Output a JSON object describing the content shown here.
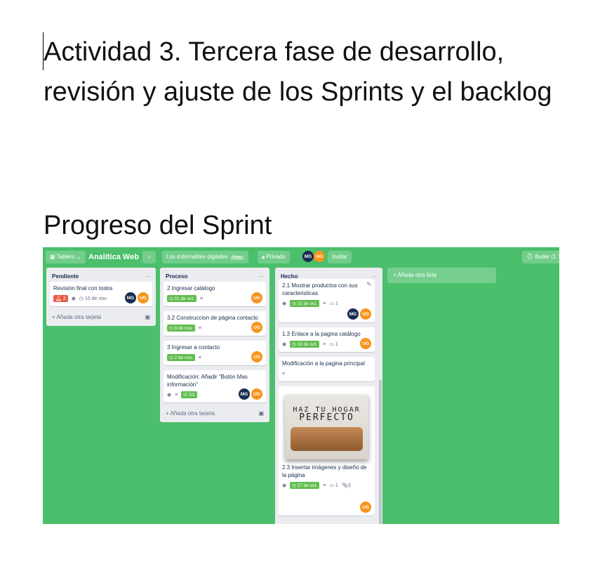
{
  "doc": {
    "title": "Actividad 3. Tercera fase de desarrollo, revisión y ajuste de los Sprints y el backlog",
    "heading": "Progreso del Sprint"
  },
  "board": {
    "tablero": "Tablero",
    "name": "Analítica Web",
    "workspace": "Los indomables digitales",
    "free": "Free",
    "privacy": "Privado",
    "invite": "Invitar",
    "butler": "Butler (1 T",
    "add_card": "Añada otra tarjeta",
    "add_list": "Añada otra lista",
    "lists": [
      {
        "title": "Pendiente",
        "cards": [
          {
            "title": "Revisión final con todos",
            "notifications": "3",
            "due": "10 de nov.",
            "members": [
              "MG",
              "UG"
            ]
          }
        ]
      },
      {
        "title": "Proceso",
        "cards": [
          {
            "title": "2 Ingresar catálogo",
            "due": "21 de oct.",
            "members": [
              "UG"
            ]
          },
          {
            "title": "3.2 Construccion de página contacto",
            "due": "9 de nov.",
            "members": [
              "UG"
            ]
          },
          {
            "title": "3 Ingresar a contacto",
            "due": "2 de nov.",
            "members": [
              "UG"
            ]
          },
          {
            "title": "Modificación: Añadir \"Botón Mas información\"",
            "checklist": "2/2",
            "members": [
              "MG",
              "UG"
            ]
          }
        ]
      },
      {
        "title": "Hecho",
        "cards": [
          {
            "title": "2.1 Mostrar productos con sus caracteristicas",
            "due": "22 de oct.",
            "comments": "1",
            "members": [
              "MG",
              "UG"
            ]
          },
          {
            "title": "1.3 Enlace a la pagina catálogo",
            "due": "19 de oct.",
            "comments": "1",
            "members": [
              "UG"
            ]
          },
          {
            "title": "Modificación a la pagina principal"
          },
          {
            "title": "2.3 Insertar imágenes y diseño de la página",
            "due": "27 de oct.",
            "comments": "1",
            "attachments": "3",
            "members": [
              "UG"
            ],
            "image_text": [
              "HAZ TU HOGAR",
              "PERFECTO"
            ]
          }
        ]
      }
    ]
  },
  "colors": {
    "board": "#4bbf6b",
    "due": "#61bd4f",
    "alert": "#eb5a46"
  }
}
